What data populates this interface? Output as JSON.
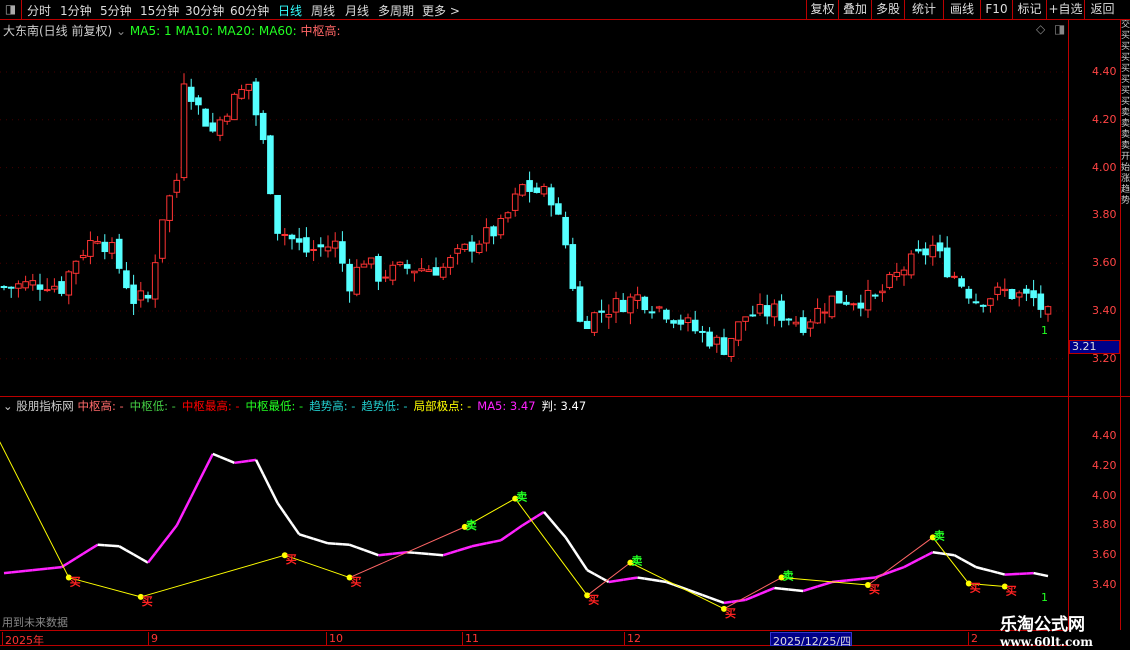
{
  "toolbar": {
    "periods": [
      "分时",
      "1分钟",
      "5分钟",
      "15分钟",
      "30分钟",
      "60分钟",
      "日线",
      "周线",
      "月线",
      "多周期",
      "更多 >"
    ],
    "active": "日线",
    "buttons": [
      "复权",
      "叠加",
      "多股",
      "统计",
      "画线",
      "F10",
      "标记",
      "+自选",
      "返回"
    ]
  },
  "main": {
    "title": "大东南(日线 前复权)",
    "ma5": "MA5: 1",
    "ma10": "MA10:",
    "ma20": "MA20:",
    "ma60": "MA60:",
    "zsg": "中枢高:",
    "yticks": [
      "4.40",
      "4.20",
      "4.00",
      "3.80",
      "3.60",
      "3.40",
      "3.20"
    ],
    "current_price": "3.21",
    "last_label": "1"
  },
  "indicator": {
    "name": "股朋指标网",
    "items": [
      {
        "label": "中枢高:",
        "value": "-",
        "color": "#ff6a6a"
      },
      {
        "label": "中枢低:",
        "value": "-",
        "color": "#4c4"
      },
      {
        "label": "中枢最高:",
        "value": "-",
        "color": "#f00"
      },
      {
        "label": "中枢最低:",
        "value": "-",
        "color": "#2f2"
      },
      {
        "label": "趋势高:",
        "value": "-",
        "color": "#2cc"
      },
      {
        "label": "趋势低:",
        "value": "-",
        "color": "#2cc"
      },
      {
        "label": "局部极点:",
        "value": "-",
        "color": "#ff0"
      },
      {
        "label": "MA5:",
        "value": "3.47",
        "color": "#f2f"
      },
      {
        "label": "判:",
        "value": "3.47",
        "color": "#fff"
      }
    ],
    "yticks": [
      "4.40",
      "4.20",
      "4.00",
      "3.80",
      "3.60",
      "3.40"
    ],
    "footer_note": "用到未来数据",
    "last_label": "1",
    "buy_label": "买",
    "sell_label": "卖"
  },
  "dates": [
    "2025年",
    "9",
    "10",
    "11",
    "12",
    "2025/12/25/四",
    "2"
  ],
  "watermark": {
    "name": "乐淘公式网",
    "url": "www.60lt.com"
  },
  "chart_data": {
    "type": "candlestick",
    "ylim": [
      3.15,
      4.55
    ],
    "close_keypoints": [
      [
        0,
        3.5
      ],
      [
        6,
        3.52
      ],
      [
        8,
        3.5
      ],
      [
        10,
        3.62
      ],
      [
        13,
        3.72
      ],
      [
        15,
        3.65
      ],
      [
        18,
        3.45
      ],
      [
        20,
        3.45
      ],
      [
        22,
        3.8
      ],
      [
        24,
        3.95
      ],
      [
        25,
        4.38
      ],
      [
        27,
        4.25
      ],
      [
        29,
        4.15
      ],
      [
        31,
        4.25
      ],
      [
        34,
        4.35
      ],
      [
        36,
        4.1
      ],
      [
        38,
        3.75
      ],
      [
        42,
        3.65
      ],
      [
        46,
        3.68
      ],
      [
        48,
        3.52
      ],
      [
        50,
        3.62
      ],
      [
        52,
        3.55
      ],
      [
        56,
        3.58
      ],
      [
        61,
        3.58
      ],
      [
        65,
        3.68
      ],
      [
        69,
        3.75
      ],
      [
        72,
        3.92
      ],
      [
        76,
        3.88
      ],
      [
        78,
        3.68
      ],
      [
        80,
        3.35
      ],
      [
        83,
        3.4
      ],
      [
        88,
        3.46
      ],
      [
        92,
        3.4
      ],
      [
        96,
        3.32
      ],
      [
        100,
        3.25
      ],
      [
        103,
        3.38
      ],
      [
        107,
        3.4
      ],
      [
        111,
        3.35
      ],
      [
        115,
        3.45
      ],
      [
        121,
        3.45
      ],
      [
        125,
        3.58
      ],
      [
        129,
        3.67
      ],
      [
        131,
        3.58
      ],
      [
        135,
        3.45
      ],
      [
        139,
        3.48
      ],
      [
        143,
        3.45
      ],
      [
        145,
        3.38
      ]
    ],
    "ma_keypoints": [
      [
        0,
        3.48
      ],
      [
        8,
        3.52
      ],
      [
        13,
        3.67
      ],
      [
        16,
        3.66
      ],
      [
        20,
        3.55
      ],
      [
        24,
        3.8
      ],
      [
        29,
        4.28
      ],
      [
        32,
        4.22
      ],
      [
        35,
        4.24
      ],
      [
        38,
        3.95
      ],
      [
        41,
        3.74
      ],
      [
        45,
        3.68
      ],
      [
        48,
        3.67
      ],
      [
        52,
        3.6
      ],
      [
        56,
        3.62
      ],
      [
        61,
        3.6
      ],
      [
        65,
        3.66
      ],
      [
        69,
        3.7
      ],
      [
        72,
        3.8
      ],
      [
        75,
        3.89
      ],
      [
        78,
        3.72
      ],
      [
        81,
        3.5
      ],
      [
        84,
        3.42
      ],
      [
        88,
        3.45
      ],
      [
        92,
        3.42
      ],
      [
        96,
        3.35
      ],
      [
        100,
        3.28
      ],
      [
        103,
        3.3
      ],
      [
        107,
        3.38
      ],
      [
        111,
        3.36
      ],
      [
        115,
        3.42
      ],
      [
        121,
        3.45
      ],
      [
        125,
        3.52
      ],
      [
        129,
        3.62
      ],
      [
        132,
        3.6
      ],
      [
        135,
        3.52
      ],
      [
        139,
        3.47
      ],
      [
        143,
        3.48
      ],
      [
        145,
        3.46
      ]
    ],
    "signals": [
      {
        "i": -1,
        "p": 4.4,
        "t": ""
      },
      {
        "i": 9,
        "p": 3.45,
        "t": "buy"
      },
      {
        "i": 19,
        "p": 3.32,
        "t": "buy"
      },
      {
        "i": 39,
        "p": 3.6,
        "t": "buy"
      },
      {
        "i": 48,
        "p": 3.45,
        "t": "buy"
      },
      {
        "i": 64,
        "p": 3.79,
        "t": "sell"
      },
      {
        "i": 71,
        "p": 3.98,
        "t": "sell"
      },
      {
        "i": 81,
        "p": 3.33,
        "t": "buy"
      },
      {
        "i": 87,
        "p": 3.55,
        "t": "sell"
      },
      {
        "i": 100,
        "p": 3.24,
        "t": "buy"
      },
      {
        "i": 108,
        "p": 3.45,
        "t": "sell"
      },
      {
        "i": 120,
        "p": 3.4,
        "t": "buy"
      },
      {
        "i": 129,
        "p": 3.72,
        "t": "sell"
      },
      {
        "i": 134,
        "p": 3.41,
        "t": "buy"
      },
      {
        "i": 139,
        "p": 3.39,
        "t": "buy"
      }
    ]
  }
}
